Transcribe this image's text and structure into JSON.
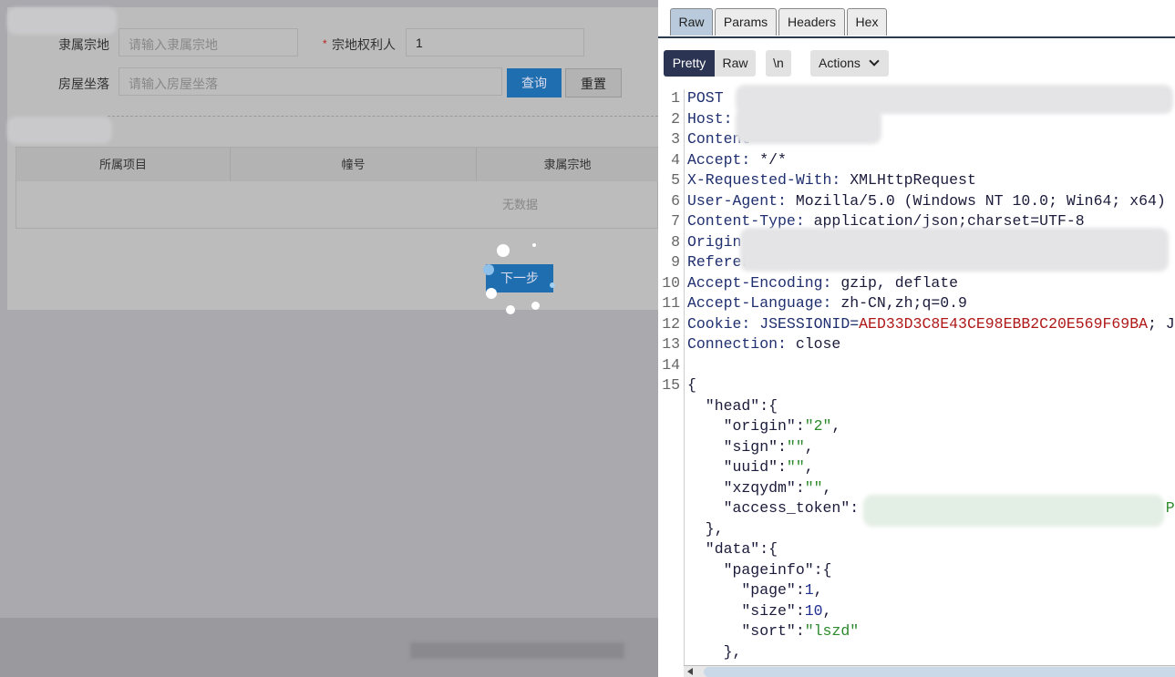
{
  "form": {
    "field1_label": "隶属宗地",
    "field1_placeholder": "请输入隶属宗地",
    "field2_required": "*",
    "field2_label": "宗地权利人",
    "field2_value": "1",
    "field3_label": "房屋坐落",
    "field3_placeholder": "请输入房屋坐落",
    "query_button": "查询",
    "reset_button": "重置"
  },
  "table": {
    "headers": [
      "所属项目",
      "幢号",
      "隶属宗地"
    ],
    "empty_text": "无数据"
  },
  "next_button": "下一步",
  "burp": {
    "tabs": [
      {
        "label": "Raw",
        "active": true
      },
      {
        "label": "Params"
      },
      {
        "label": "Headers"
      },
      {
        "label": "Hex"
      }
    ],
    "toolbar": {
      "pretty": "Pretty",
      "raw": "Raw",
      "newline": "\\n",
      "actions": "Actions"
    },
    "lines": [
      {
        "n": "1",
        "parts": [
          [
            "h",
            "POST"
          ]
        ]
      },
      {
        "n": "2",
        "parts": [
          [
            "h",
            "Host:"
          ]
        ]
      },
      {
        "n": "3",
        "parts": [
          [
            "h",
            "Content"
          ]
        ]
      },
      {
        "n": "4",
        "parts": [
          [
            "h",
            "Accept: "
          ],
          [
            "k",
            "*/*"
          ]
        ]
      },
      {
        "n": "5",
        "parts": [
          [
            "h",
            "X-Requested-With: "
          ],
          [
            "k",
            "XMLHttpRequest"
          ]
        ]
      },
      {
        "n": "6",
        "parts": [
          [
            "h",
            "User-Agent: "
          ],
          [
            "k",
            "Mozilla/5.0 (Windows NT 10.0; Win64; x64)"
          ]
        ]
      },
      {
        "n": "7",
        "parts": [
          [
            "h",
            "Content-Type: "
          ],
          [
            "k",
            "application/json;charset=UTF-8"
          ]
        ]
      },
      {
        "n": "8",
        "parts": [
          [
            "h",
            "Origin"
          ]
        ]
      },
      {
        "n": "9",
        "parts": [
          [
            "h",
            "Referer"
          ]
        ]
      },
      {
        "n": "10",
        "parts": [
          [
            "h",
            "Accept-Encoding: "
          ],
          [
            "k",
            "gzip, deflate"
          ]
        ]
      },
      {
        "n": "11",
        "parts": [
          [
            "h",
            "Accept-Language: "
          ],
          [
            "k",
            "zh-CN,zh;q=0.9"
          ]
        ]
      },
      {
        "n": "12",
        "parts": [
          [
            "h",
            "Cookie: "
          ],
          [
            "h",
            "JSESSIONID="
          ],
          [
            "r",
            "AED33D3C8E43CE98EBB2C20E569F69BA"
          ],
          [
            "k",
            "; J"
          ]
        ]
      },
      {
        "n": "13",
        "parts": [
          [
            "h",
            "Connection: "
          ],
          [
            "k",
            "close"
          ]
        ]
      },
      {
        "n": "14",
        "parts": []
      },
      {
        "n": "15",
        "parts": [
          [
            "k",
            "{"
          ]
        ]
      },
      {
        "n": "",
        "parts": [
          [
            "k",
            "  \"head\":{"
          ]
        ]
      },
      {
        "n": "",
        "parts": [
          [
            "k",
            "    \"origin\":"
          ],
          [
            "s",
            "\"2\""
          ],
          [
            "k",
            ","
          ]
        ]
      },
      {
        "n": "",
        "parts": [
          [
            "k",
            "    \"sign\":"
          ],
          [
            "s",
            "\"\""
          ],
          [
            "k",
            ","
          ]
        ]
      },
      {
        "n": "",
        "parts": [
          [
            "k",
            "    \"uuid\":"
          ],
          [
            "s",
            "\"\""
          ],
          [
            "k",
            ","
          ]
        ]
      },
      {
        "n": "",
        "parts": [
          [
            "k",
            "    \"xzqydm\":"
          ],
          [
            "s",
            "\"\""
          ],
          [
            "k",
            ","
          ]
        ]
      },
      {
        "n": "",
        "parts": [
          [
            "k",
            "    \"access_token\":"
          ],
          [
            "s",
            "                                  Pu"
          ]
        ]
      },
      {
        "n": "",
        "parts": [
          [
            "k",
            "  },"
          ]
        ]
      },
      {
        "n": "",
        "parts": [
          [
            "k",
            "  \"data\":{"
          ]
        ]
      },
      {
        "n": "",
        "parts": [
          [
            "k",
            "    \"pageinfo\":{"
          ]
        ]
      },
      {
        "n": "",
        "parts": [
          [
            "k",
            "      \"page\":"
          ],
          [
            "n",
            "1"
          ],
          [
            "k",
            ","
          ]
        ]
      },
      {
        "n": "",
        "parts": [
          [
            "k",
            "      \"size\":"
          ],
          [
            "n",
            "10"
          ],
          [
            "k",
            ","
          ]
        ]
      },
      {
        "n": "",
        "parts": [
          [
            "k",
            "      \"sort\":"
          ],
          [
            "s",
            "\"lszd\""
          ]
        ]
      },
      {
        "n": "",
        "parts": [
          [
            "k",
            "    },"
          ]
        ]
      }
    ]
  },
  "colors": {
    "accent": "#1f6fb0",
    "cookie_value": "#b01818",
    "string": "#2c8a2c",
    "active_toggle": "#2b3553"
  }
}
